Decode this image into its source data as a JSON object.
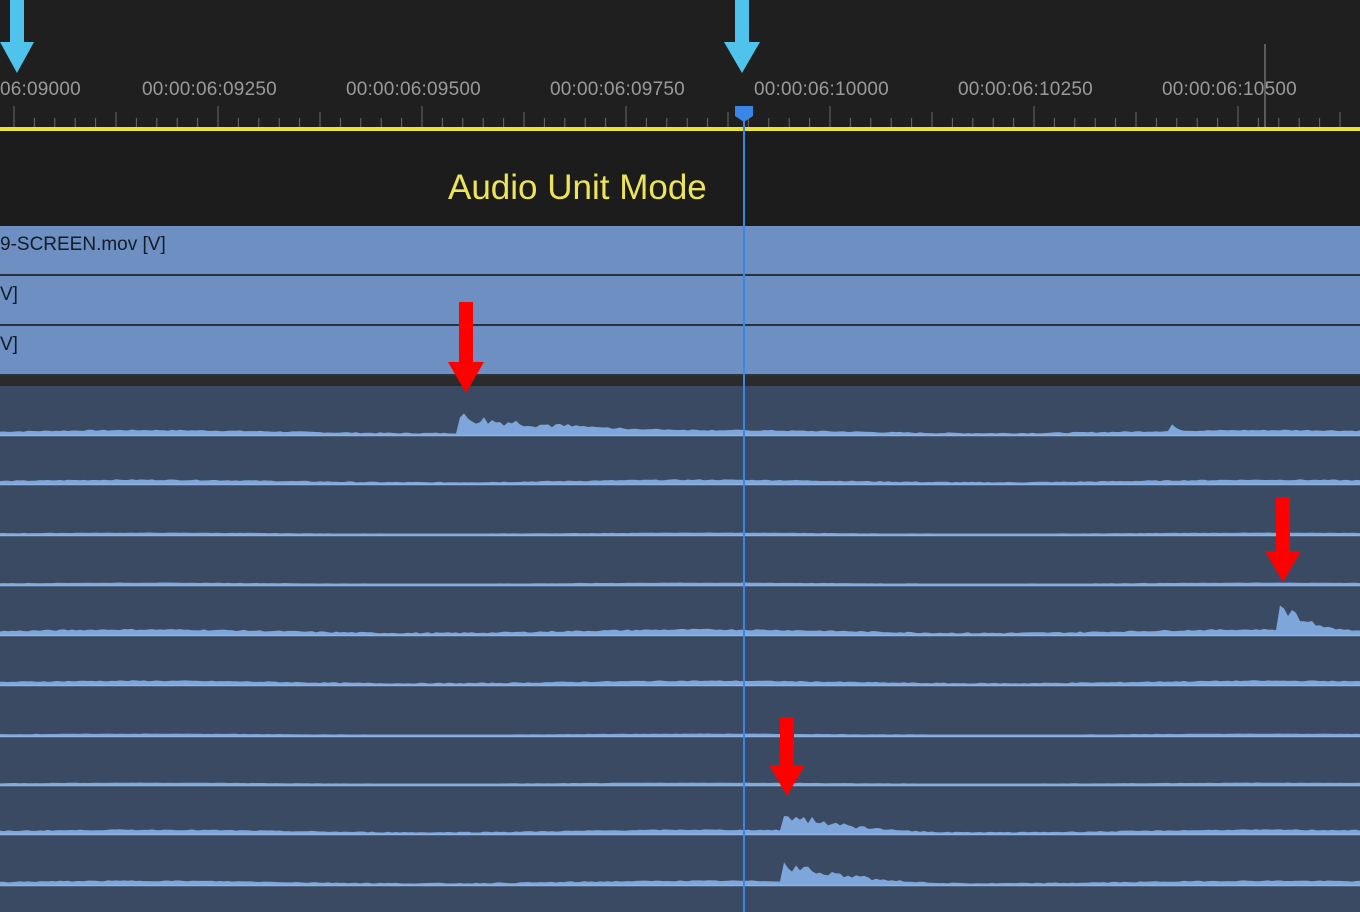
{
  "ruler": {
    "timecodes": [
      "06:09000",
      "00:00:06:09250",
      "00:00:06:09500",
      "00:00:06:09750",
      "00:00:06:10000",
      "00:00:06:10250",
      "00:00:06:10500"
    ]
  },
  "mode": {
    "label": "Audio Unit Mode"
  },
  "video_tracks": [
    {
      "label": "9-SCREEN.mov [V]"
    },
    {
      "label": "V]"
    },
    {
      "label": "V]"
    }
  ],
  "colors": {
    "ruler_line": "#e9e233",
    "playhead": "#3a86e6",
    "marker_arrow": "#4fc3ec",
    "annotation_arrow": "#ff0000",
    "video_clip": "#6d8fc2",
    "audio_track": "#3a4a62",
    "waveform": "#7ea6da"
  },
  "icons": {
    "marker": "down-arrow-marker-icon",
    "annotation": "red-down-arrow-icon",
    "playhead": "playhead-handle-icon"
  }
}
